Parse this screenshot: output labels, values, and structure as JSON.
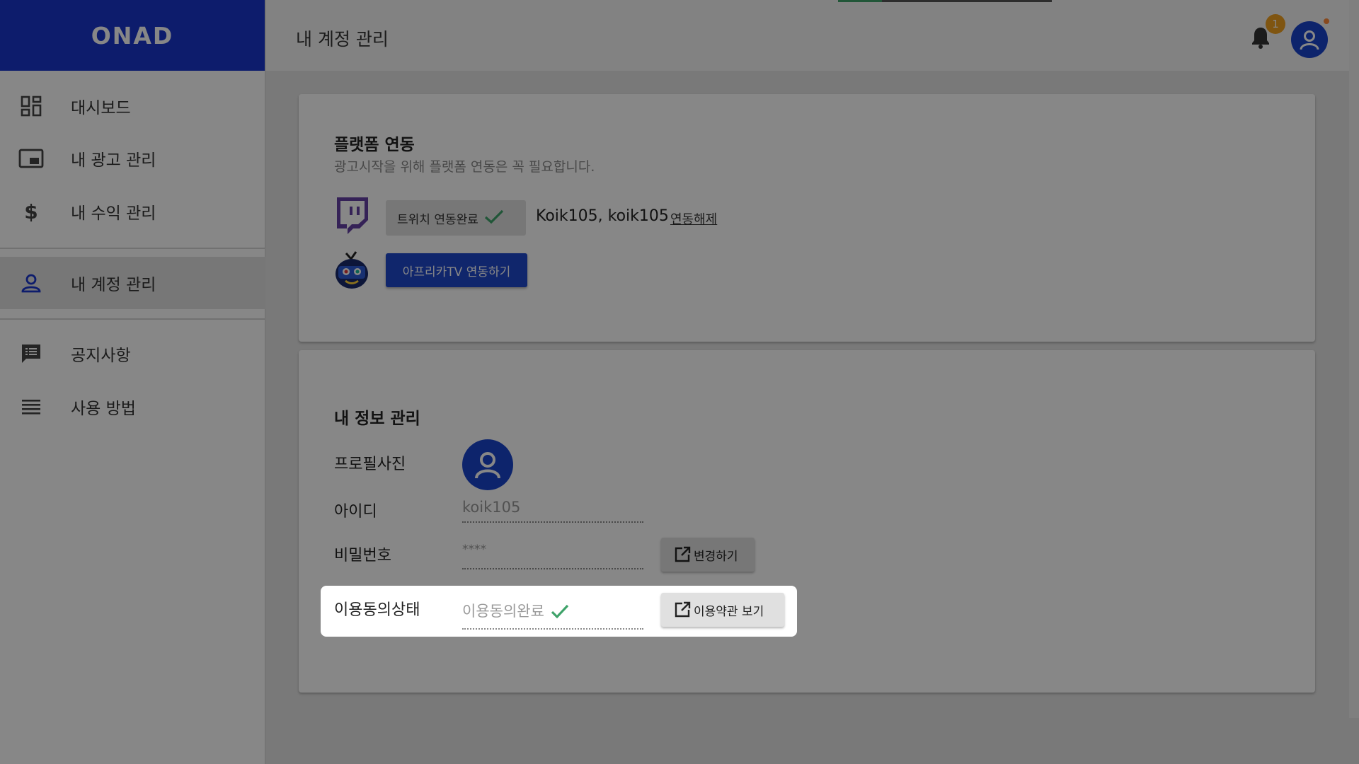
{
  "app": {
    "logo": "ONAD"
  },
  "sidebar": {
    "items": [
      {
        "label": "대시보드",
        "icon": "dashboard-icon"
      },
      {
        "label": "내 광고 관리",
        "icon": "ad-icon"
      },
      {
        "label": "내 수익 관리",
        "icon": "dollar-icon"
      },
      {
        "label": "내 계정 관리",
        "icon": "person-icon",
        "active": true
      },
      {
        "label": "공지사항",
        "icon": "notice-icon"
      },
      {
        "label": "사용 방법",
        "icon": "list-icon"
      }
    ]
  },
  "header": {
    "title": "내 계정 관리",
    "notification_count": "1"
  },
  "platform": {
    "title": "플랫폼 연동",
    "subtitle": "광고시작을 위해 플랫폼 연동은 꼭 필요합니다.",
    "twitch": {
      "status_label": "트위치 연동완료",
      "account": "Koik105, koik105",
      "unlink_label": "연동해제"
    },
    "afreeca": {
      "button_label": "아프리카TV 연동하기"
    }
  },
  "info": {
    "title": "내 정보 관리",
    "profile_label": "프로필사진",
    "id_label": "아이디",
    "id_value": "koik105",
    "password_label": "비밀번호",
    "password_value": "****",
    "change_button": "변경하기",
    "consent_label": "이용동의상태",
    "consent_value": "이용동의완료",
    "terms_button": "이용약관 보기"
  },
  "colors": {
    "brand": "#1a35cc",
    "twitch": "#6441a5",
    "badge": "#f0a020",
    "check": "#3fa36a"
  }
}
